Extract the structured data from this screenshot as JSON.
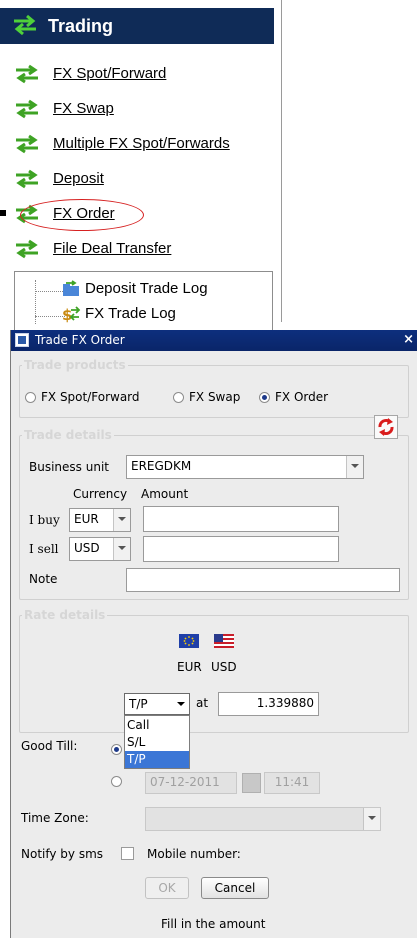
{
  "trading_menu": {
    "title": "Trading",
    "links": [
      "FX Spot/Forward",
      "FX Swap",
      "Multiple FX Spot/Forwards",
      "Deposit",
      "FX Order",
      "File Deal Transfer"
    ],
    "tree_items": [
      "Deposit Trade Log",
      "FX Trade Log"
    ]
  },
  "dialog": {
    "title": "Trade FX Order",
    "close_label": "×",
    "trade_products": {
      "legend": "Trade products",
      "options": [
        "FX Spot/Forward",
        "FX Swap",
        "FX Order"
      ],
      "selected": "FX Order"
    },
    "trade_details": {
      "legend": "Trade details",
      "business_unit_label": "Business unit",
      "business_unit_value": "EREGDKM",
      "currency_header": "Currency",
      "amount_header": "Amount",
      "buy_label": "I buy",
      "buy_currency": "EUR",
      "buy_amount": "",
      "sell_label": "I sell",
      "sell_currency": "USD",
      "sell_amount": "",
      "note_label": "Note",
      "note_value": ""
    },
    "rate_details": {
      "legend": "Rate details",
      "currency_left": "EUR",
      "currency_right": "USD",
      "order_type_value": "T/P",
      "at_label": "at",
      "rate_value": "1.339880",
      "order_type_options": [
        "Call",
        "S/L",
        "T/P"
      ],
      "order_type_selected": "T/P"
    },
    "good_till": {
      "label": "Good Till:",
      "date": "07-12-2011",
      "time": "11:41"
    },
    "time_zone": {
      "label": "Time Zone:",
      "value": ""
    },
    "notify": {
      "sms_label": "Notify by sms",
      "mobile_label": "Mobile number:"
    },
    "buttons": {
      "ok": "OK",
      "cancel": "Cancel"
    },
    "status": "Fill in the amount"
  },
  "colors": {
    "header_bg": "#0f2b57",
    "titlebar_bg": "#0d2f7e",
    "icon_green": "#3ea324",
    "highlight_ellipse": "#d62020",
    "selection_blue": "#3b76d6",
    "swap_red": "#d91c1c"
  }
}
